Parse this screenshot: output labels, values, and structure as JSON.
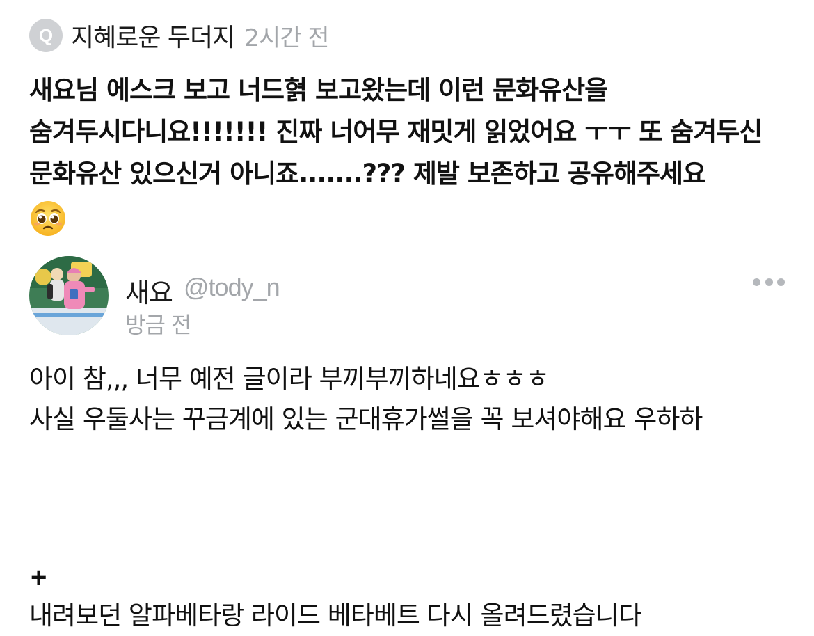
{
  "question": {
    "badge_letter": "Q",
    "asker_name": "지혜로운 두더지",
    "time_ago": "2시간 전",
    "body": "새요님 에스크 보고 너드혉 보고왔는데 이런 문화유산을 숨겨두시다니요!!!!!!! 진짜 너어무 재밋게 읽었어요 ㅜㅜ 또 숨겨두신 문화유산 있으신거 아니죠.......??? 제발 보존하고 공유해주세요",
    "emoji": "pleading-face"
  },
  "answer": {
    "display_name": "새요",
    "handle": "@tody_n",
    "time_ago": "방금 전",
    "more_icon": "more-horizontal-icon",
    "lines": [
      "아이 참,,, 너무 예전 글이라 부끼부끼하네요ㅎㅎㅎ",
      "사실 우둘사는 꾸금계에 있는 군대휴가썰을 꼭 보셔야해요 우하하"
    ],
    "plus": "+",
    "cut_line": "내려보던 알파베타랑 라이드 베타베트 다시 올려드렸습니다"
  },
  "colors": {
    "text_primary": "#111111",
    "text_muted": "#a3a6aa",
    "badge_bg": "#cfd1d4",
    "background": "#ffffff"
  }
}
